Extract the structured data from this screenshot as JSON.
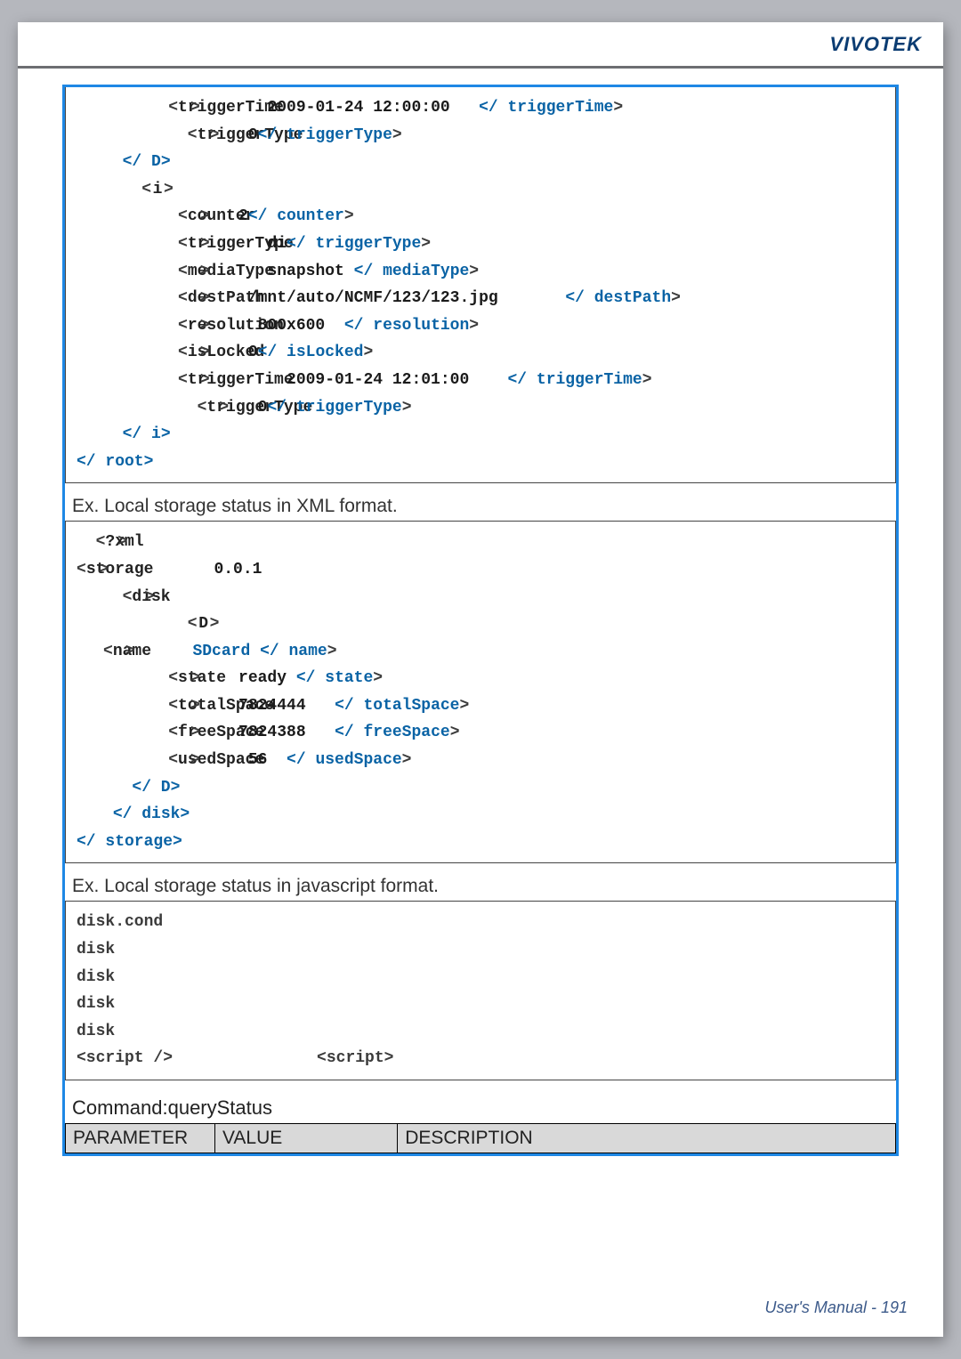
{
  "brand": "VIVOTEK",
  "block1": {
    "triggerTime1": "2009-01-24 12:00:00",
    "triggerType1": "0",
    "counter": "2",
    "triggerSub": "di",
    "mediaType": "snapshot",
    "destPath": "/mnt/auto/NCMF/123/123.jpg",
    "resolution": "800x600",
    "isLocked": "0",
    "triggerTime2": "2009-01-24 12:01:00",
    "triggerType2": "0"
  },
  "caption1": "Ex. Local storage status in XML format.",
  "block2": {
    "version": "0.0.1",
    "name": "SDcard",
    "state": "ready",
    "totalSpace": "7824444",
    "freeSpace": "7824388",
    "usedSpace": "56"
  },
  "caption2": "Ex. Local storage status in javascript format.",
  "command": "Command:queryStatus",
  "table": {
    "col1": "PARAMETER",
    "col2": "VALUE",
    "col3": "DESCRIPTION"
  },
  "footer": "User's Manual - 191"
}
